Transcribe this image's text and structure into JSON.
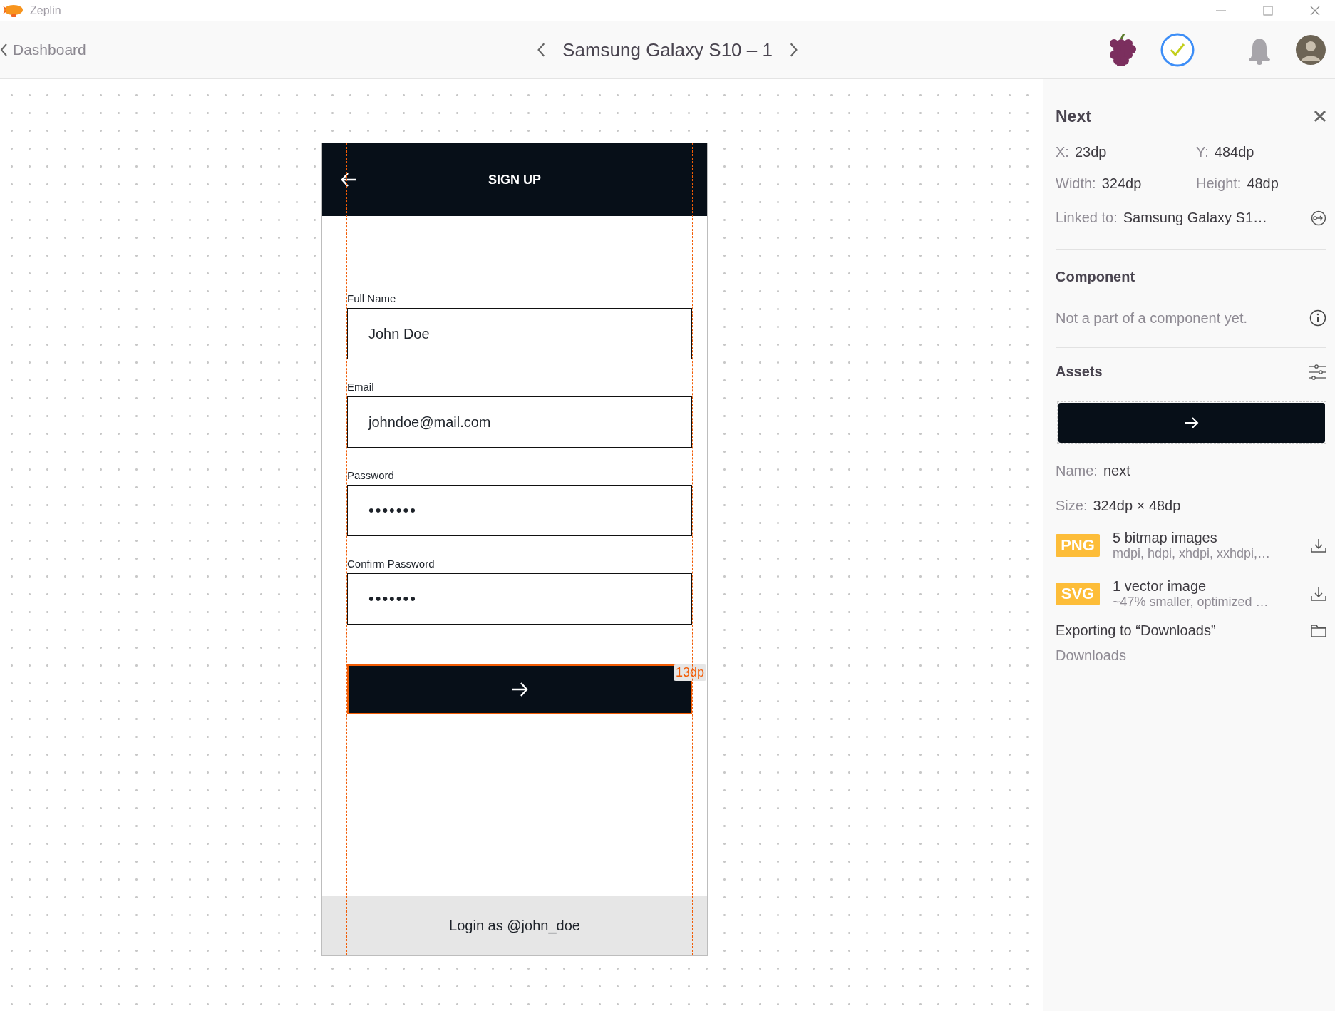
{
  "app": {
    "title": "Zeplin"
  },
  "toolbar": {
    "back_link": "Dashboard",
    "screen_title": "Samsung Galaxy S10 – 1"
  },
  "mockup": {
    "header_title": "SIGN UP",
    "fields": [
      {
        "label": "Full Name",
        "value": "John Doe"
      },
      {
        "label": "Email",
        "value": "johndoe@mail.com"
      },
      {
        "label": "Password",
        "value": "•••••••"
      },
      {
        "label": "Confirm Password",
        "value": "•••••••"
      }
    ],
    "next_button": {
      "selected": true,
      "measurement": "13dp"
    },
    "footer_text": "Login as @john_doe"
  },
  "inspector": {
    "title": "Next",
    "properties": [
      {
        "label": "X:",
        "value": "23dp"
      },
      {
        "label": "Y:",
        "value": "484dp"
      },
      {
        "label": "Width:",
        "value": "324dp"
      },
      {
        "label": "Height:",
        "value": "48dp"
      }
    ],
    "linked_to": {
      "label": "Linked to:",
      "value": "Samsung Galaxy S1…"
    },
    "component": {
      "heading": "Component",
      "note": "Not a part of a component yet."
    },
    "assets": {
      "heading": "Assets",
      "name_label": "Name:",
      "name": "next",
      "size_label": "Size:",
      "size": "324dp × 48dp",
      "formats": [
        {
          "badge": "PNG",
          "title": "5 bitmap images",
          "detail": "mdpi, hdpi, xhdpi, xxhdpi,…"
        },
        {
          "badge": "SVG",
          "title": "1 vector image",
          "detail": "~47% smaller, optimized …"
        }
      ],
      "export": {
        "title": "Exporting to “Downloads”",
        "folder": "Downloads"
      }
    }
  }
}
